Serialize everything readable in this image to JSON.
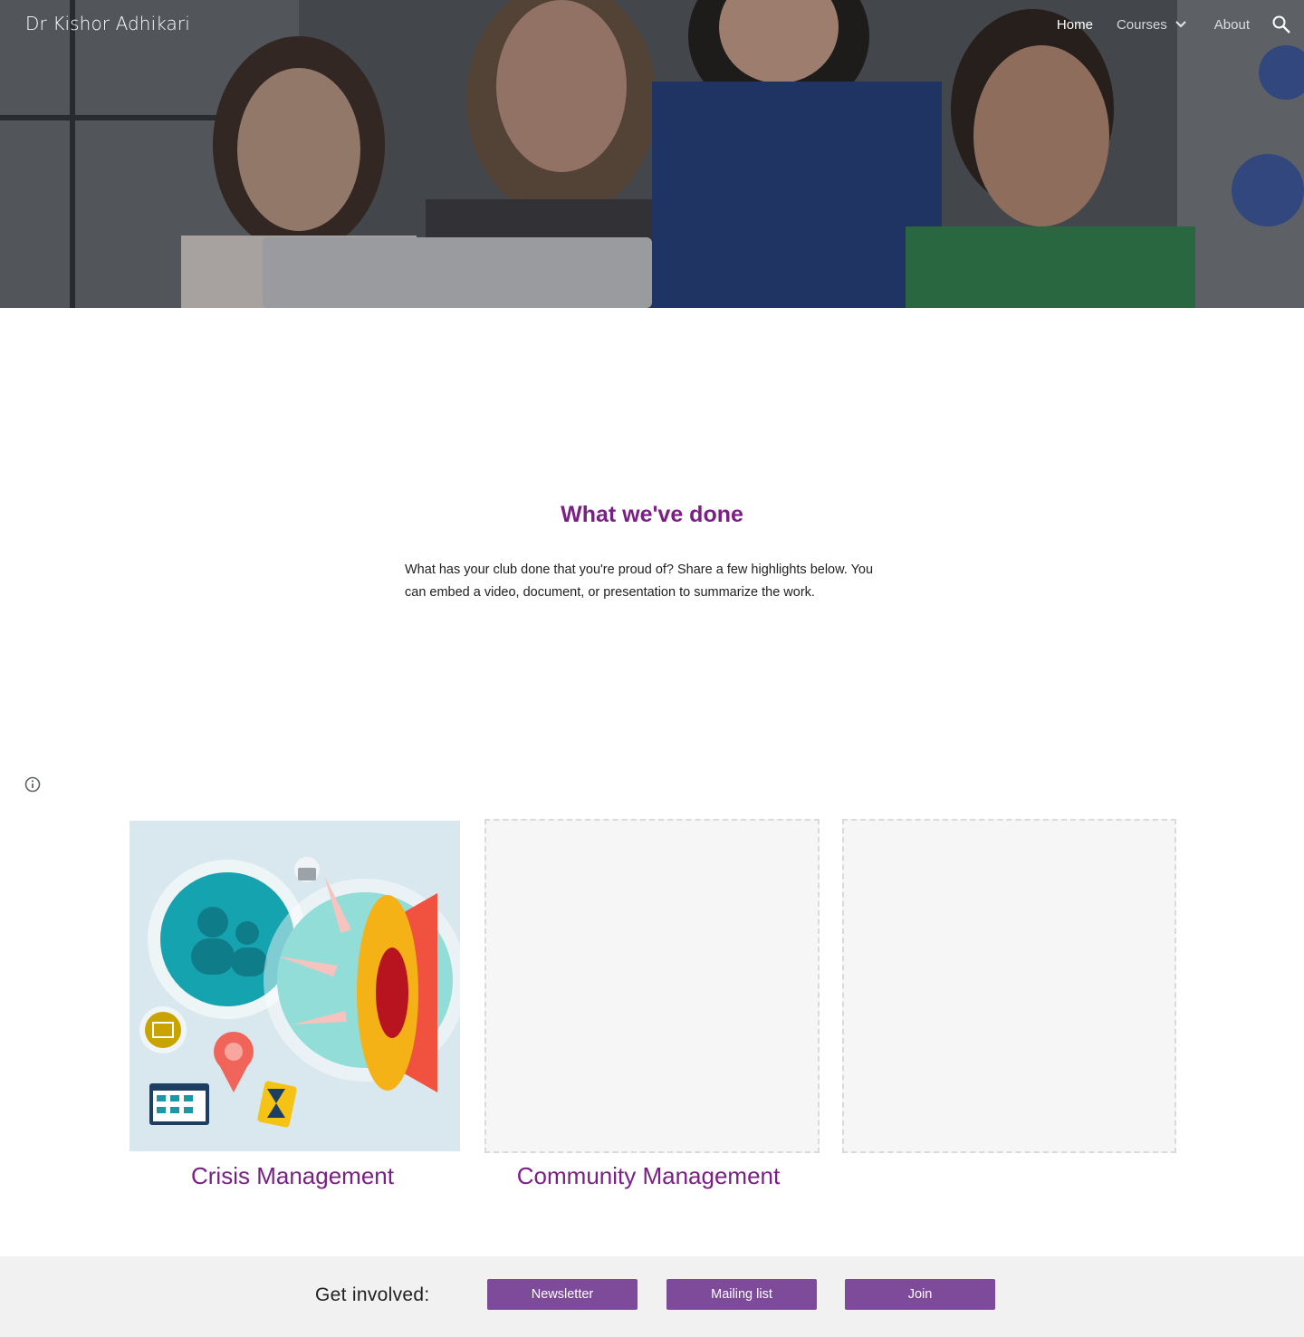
{
  "site": {
    "title": "Dr Kishor Adhikari"
  },
  "nav": {
    "items": [
      {
        "label": "Home",
        "active": true
      },
      {
        "label": "Courses",
        "has_dropdown": true
      },
      {
        "label": "About"
      }
    ],
    "search_icon": "search-icon",
    "dropdown_icon": "chevron-down-icon"
  },
  "section": {
    "title": "What we've done",
    "body": "What has your club done that you're proud of? Share a few highlights below. You can embed a video, document, or presentation to summarize the work."
  },
  "cards": [
    {
      "title": "Crisis Management",
      "image": "megaphone-illustration"
    },
    {
      "title": "Community Management",
      "image": "empty-placeholder"
    },
    {
      "title": "",
      "image": "empty-placeholder"
    }
  ],
  "footer": {
    "label": "Get involved:",
    "buttons": [
      "Newsletter",
      "Mailing list",
      "Join"
    ]
  },
  "colors": {
    "accent": "#7b1f86",
    "button": "#7e4b9a",
    "footer_bg": "#f1f1f1"
  },
  "info_icon": "info-icon"
}
